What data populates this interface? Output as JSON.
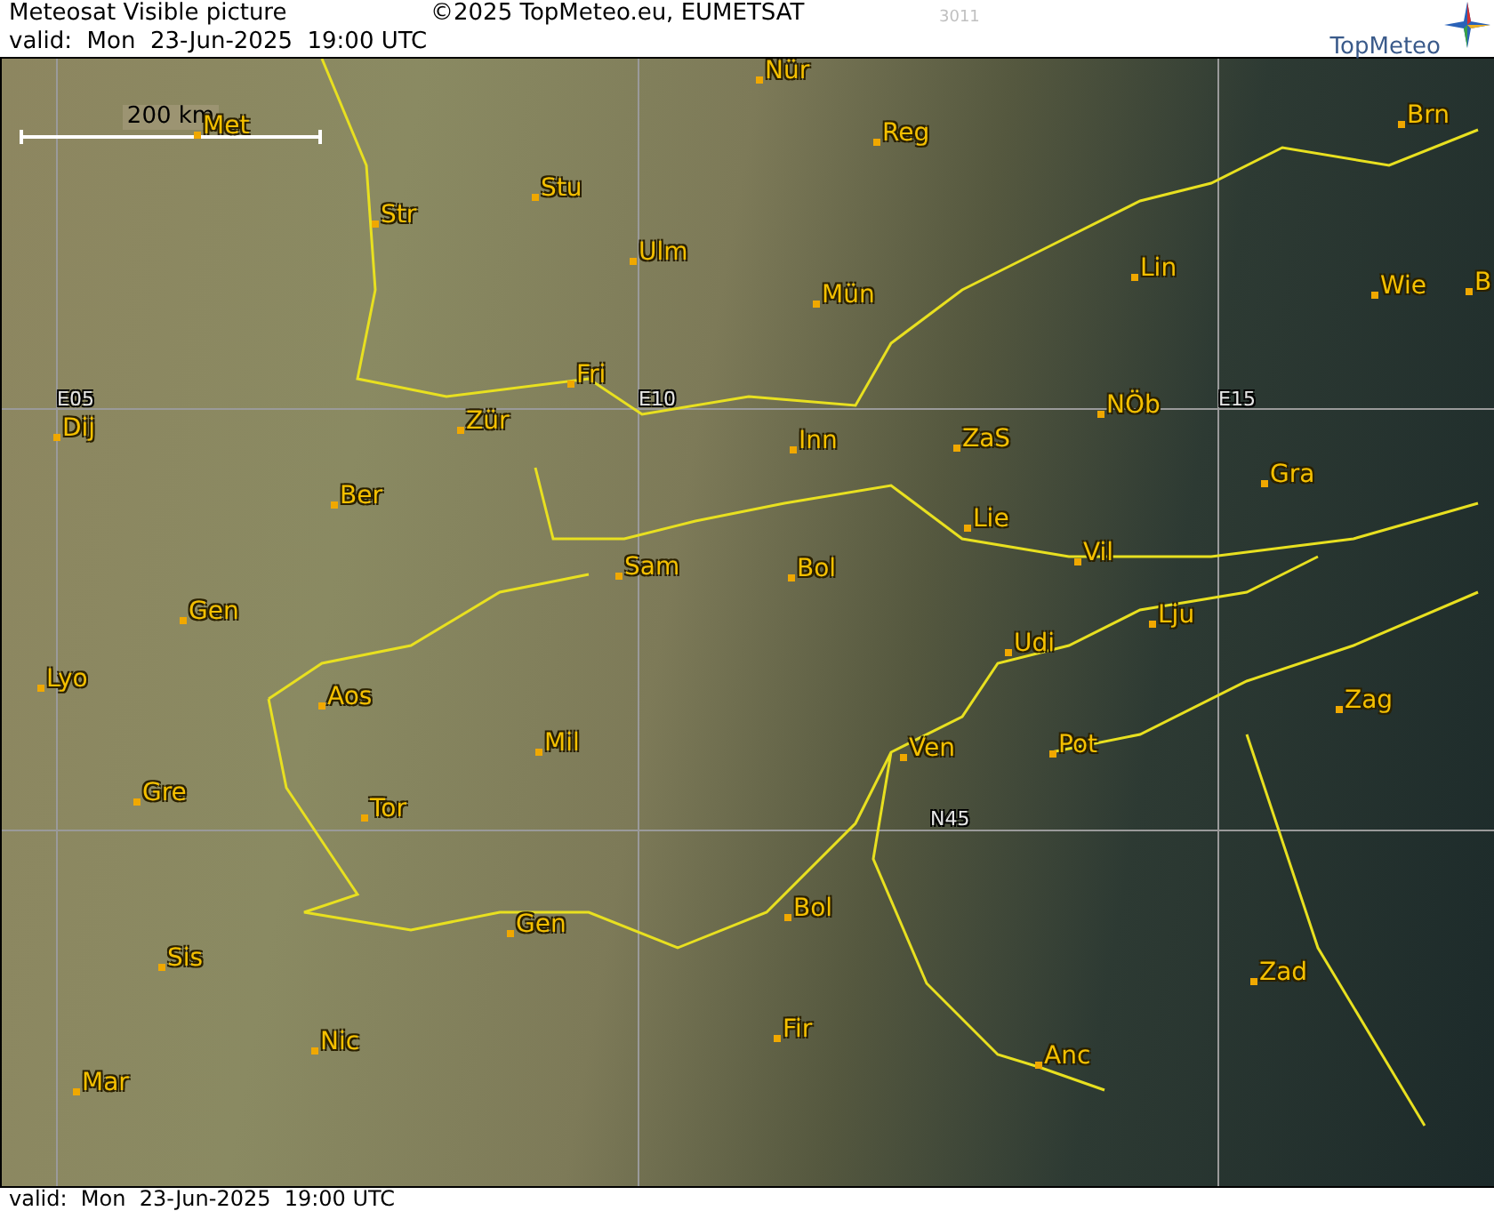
{
  "header": {
    "title": "Meteosat Visible picture",
    "valid": "valid:  Mon  23-Jun-2025  19:00 UTC",
    "copyright": "©2025 TopMeteo.eu, EUMETSAT",
    "code": "3011",
    "logo": "TopMeteo"
  },
  "map": {
    "scale": "200 km",
    "grid_labels": [
      "E05",
      "E10",
      "E15",
      "N45"
    ],
    "cities": [
      "Nür",
      "Met",
      "Reg",
      "Brn",
      "Stu",
      "Str",
      "Ulm",
      "Lin",
      "Mün",
      "Wie",
      "B",
      "Fri",
      "Dij",
      "Zür",
      "Inn",
      "ZaS",
      "NÖb",
      "Gra",
      "Ber",
      "Lie",
      "Vil",
      "Sam",
      "Bol",
      "Gen",
      "Lju",
      "Udi",
      "Lyo",
      "Aos",
      "Zag",
      "Mil",
      "Ven",
      "Pot",
      "Gre",
      "Tor",
      "Gen",
      "Bol",
      "Zad",
      "Sis",
      "Anc",
      "Nic",
      "Fir",
      "Mar"
    ]
  },
  "footer": {
    "valid": "valid:  Mon  23-Jun-2025  19:00 UTC"
  }
}
